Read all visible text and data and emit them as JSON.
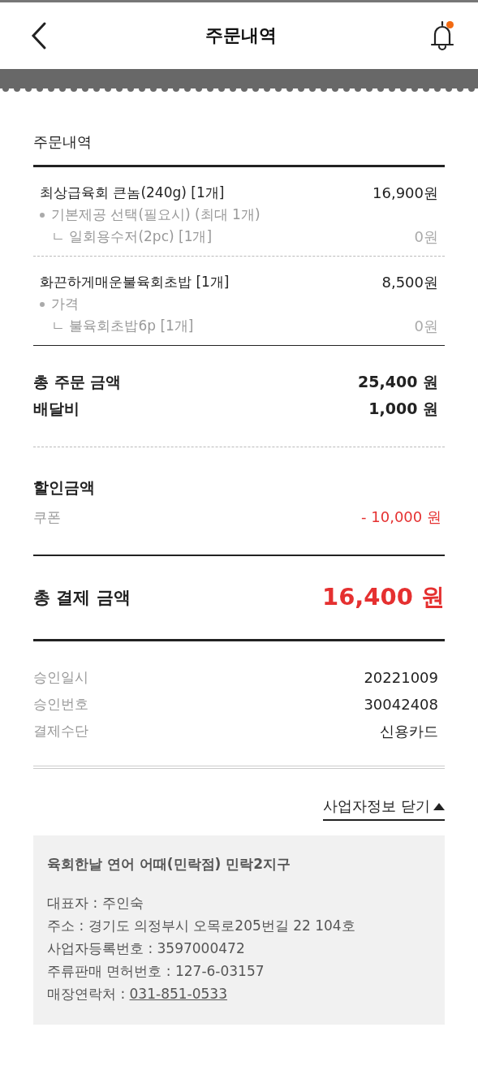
{
  "header": {
    "title": "주문내역",
    "has_notification": true
  },
  "order": {
    "section_title": "주문내역",
    "items": [
      {
        "name": "최상급육회 큰놈(240g) [1개]",
        "price": "16,900원",
        "options": [
          {
            "group": "기본제공 선택(필요시) (최대 1개)",
            "choice": "ㄴ 일회용수저(2pc) [1개]",
            "price": "0원"
          }
        ]
      },
      {
        "name": "화끈하게매운불육회초밥 [1개]",
        "price": "8,500원",
        "options": [
          {
            "group": "가격",
            "choice": "ㄴ 불육회초밥6p [1개]",
            "price": "0원"
          }
        ]
      }
    ]
  },
  "summary": [
    {
      "label": "총 주문 금액",
      "value": "25,400 원"
    },
    {
      "label": "배달비",
      "value": "1,000 원"
    }
  ],
  "discount": {
    "title": "할인금액",
    "rows": [
      {
        "label": "쿠폰",
        "value": "- 10,000 원"
      }
    ]
  },
  "total": {
    "label": "총 결제 금액",
    "value": "16,400 원"
  },
  "approval": [
    {
      "label": "승인일시",
      "value": "20221009"
    },
    {
      "label": "승인번호",
      "value": "30042408"
    },
    {
      "label": "결제수단",
      "value": "신용카드"
    }
  ],
  "business": {
    "toggle_label": "사업자정보 닫기",
    "expanded": true,
    "name": "육회한날 연어 어때(민락점) 민락2지구",
    "details": [
      {
        "kind": "text",
        "text": "대표자 : 주인숙"
      },
      {
        "kind": "text",
        "text": "주소 : 경기도 의정부시 오목로205번길 22 104호"
      },
      {
        "kind": "text",
        "text": "사업자등록번호 : 3597000472"
      },
      {
        "kind": "text",
        "text": "주류판매 면허번호 : 127-6-03157"
      },
      {
        "kind": "phone",
        "label": "매장연락처 : ",
        "link": "031-851-0533"
      }
    ]
  }
}
